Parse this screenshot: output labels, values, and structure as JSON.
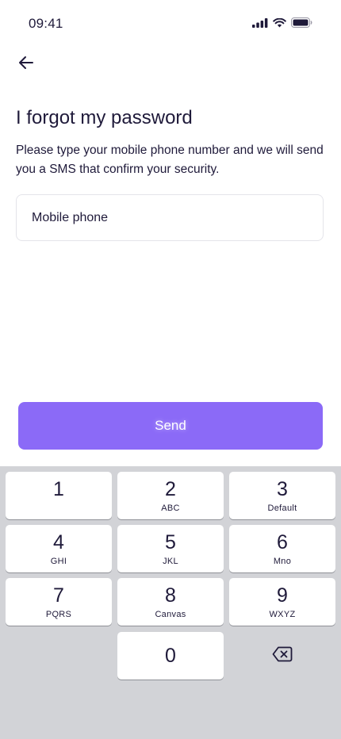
{
  "status_bar": {
    "time": "09:41"
  },
  "header": {
    "back_icon": "arrow-left-icon"
  },
  "main": {
    "title": "I forgot my password",
    "subtitle": "Please type your mobile phone number and we will send you a SMS that confirm your security.",
    "phone_placeholder": "Mobile phone",
    "send_label": "Send"
  },
  "colors": {
    "accent": "#8b6af7",
    "text": "#1f1a3a",
    "keypad_bg": "#d2d3d7"
  },
  "keypad": {
    "keys": [
      {
        "digit": "1",
        "letters": ""
      },
      {
        "digit": "2",
        "letters": "ABC"
      },
      {
        "digit": "3",
        "letters": "Default"
      },
      {
        "digit": "4",
        "letters": "GHI"
      },
      {
        "digit": "5",
        "letters": "JKL"
      },
      {
        "digit": "6",
        "letters": "Mno"
      },
      {
        "digit": "7",
        "letters": "PQRS"
      },
      {
        "digit": "8",
        "letters": "Canvas"
      },
      {
        "digit": "9",
        "letters": "WXYZ"
      },
      {
        "digit": "0",
        "letters": ""
      }
    ],
    "delete_icon": "backspace-icon"
  }
}
